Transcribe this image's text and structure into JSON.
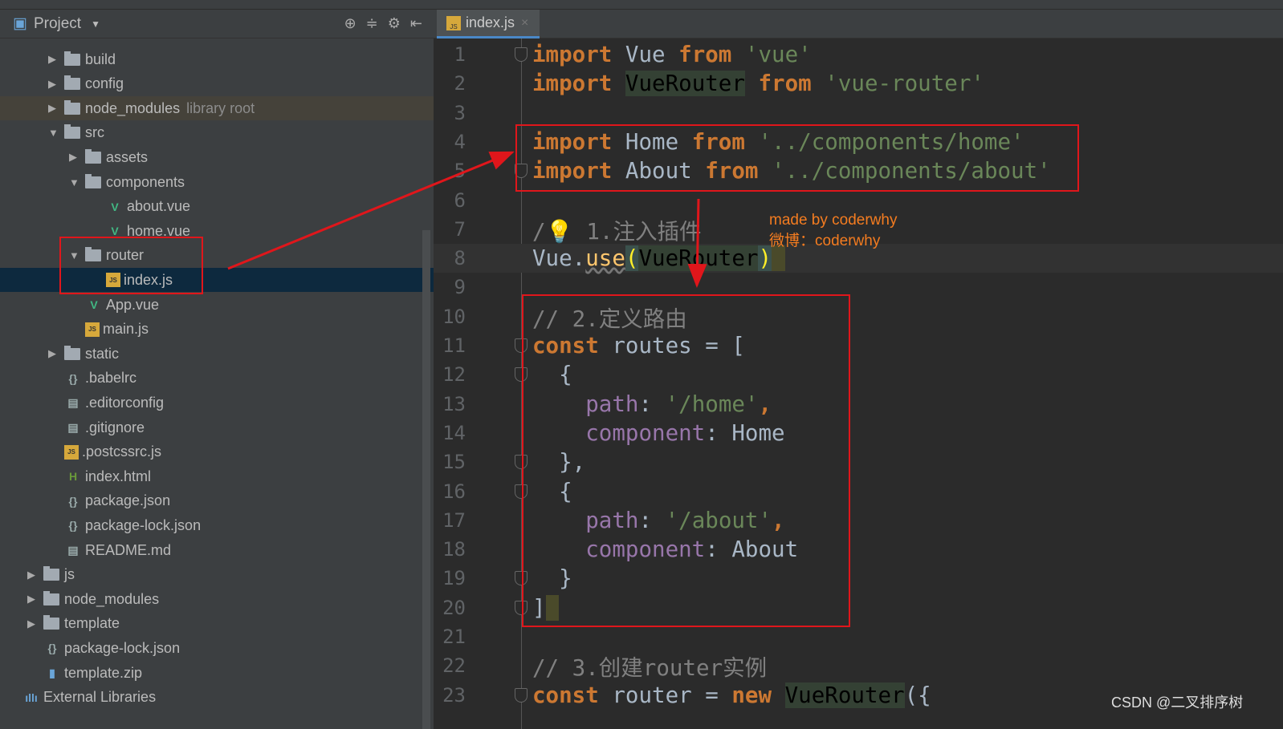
{
  "project_panel": {
    "title": "Project",
    "tools": [
      "⊕",
      "≑",
      "⚙",
      "⇤"
    ],
    "rows": [
      {
        "label": "build",
        "type": "folder",
        "depth": 1,
        "arrow": "right"
      },
      {
        "label": "config",
        "type": "folder",
        "depth": 1,
        "arrow": "right"
      },
      {
        "label": "node_modules",
        "hint": "library root",
        "type": "folder",
        "depth": 1,
        "arrow": "right",
        "lib": true
      },
      {
        "label": "src",
        "type": "folder",
        "depth": 1,
        "arrow": "down"
      },
      {
        "label": "assets",
        "type": "folder",
        "depth": 2,
        "arrow": "right"
      },
      {
        "label": "components",
        "type": "folder",
        "depth": 2,
        "arrow": "down"
      },
      {
        "label": "about.vue",
        "type": "vue",
        "depth": 3
      },
      {
        "label": "home.vue",
        "type": "vue",
        "depth": 3
      },
      {
        "label": "router",
        "type": "folder",
        "depth": 2,
        "arrow": "down"
      },
      {
        "label": "index.js",
        "type": "js",
        "depth": 3,
        "selected": true
      },
      {
        "label": "App.vue",
        "type": "vue",
        "depth": 2
      },
      {
        "label": "main.js",
        "type": "js",
        "depth": 2
      },
      {
        "label": "static",
        "type": "folder",
        "depth": 1,
        "arrow": "right"
      },
      {
        "label": ".babelrc",
        "type": "config",
        "depth": 1
      },
      {
        "label": ".editorconfig",
        "type": "text",
        "depth": 1
      },
      {
        "label": ".gitignore",
        "type": "text",
        "depth": 1
      },
      {
        "label": ".postcssrc.js",
        "type": "js",
        "depth": 1
      },
      {
        "label": "index.html",
        "type": "html",
        "depth": 1
      },
      {
        "label": "package.json",
        "type": "config",
        "depth": 1
      },
      {
        "label": "package-lock.json",
        "type": "config",
        "depth": 1
      },
      {
        "label": "README.md",
        "type": "text",
        "depth": 1
      },
      {
        "label": "js",
        "type": "folder",
        "depth": 0,
        "arrow": "right"
      },
      {
        "label": "node_modules",
        "type": "folder",
        "depth": 0,
        "arrow": "right"
      },
      {
        "label": "template",
        "type": "folder",
        "depth": 0,
        "arrow": "right"
      },
      {
        "label": "package-lock.json",
        "type": "config",
        "depth": 0
      },
      {
        "label": "template.zip",
        "type": "zip",
        "depth": 0
      },
      {
        "label": "External Libraries",
        "type": "libs",
        "depth": -1
      }
    ]
  },
  "editor": {
    "tab": {
      "label": "index.js",
      "close": "×"
    },
    "lines": [
      {
        "n": "1",
        "fold": true,
        "t": [
          [
            "kw",
            "import"
          ],
          [
            "id",
            " Vue "
          ],
          [
            "kw",
            "from"
          ],
          [
            "str",
            " 'vue'"
          ]
        ]
      },
      {
        "n": "2",
        "t": [
          [
            "kw",
            "import"
          ],
          [
            "id",
            " "
          ],
          [
            "hl",
            "VueRouter"
          ],
          [
            "id",
            " "
          ],
          [
            "kw",
            "from"
          ],
          [
            "str",
            " 'vue-router'"
          ]
        ]
      },
      {
        "n": "3",
        "t": []
      },
      {
        "n": "4",
        "t": [
          [
            "kw",
            "import"
          ],
          [
            "id",
            " Home "
          ],
          [
            "kw",
            "from"
          ],
          [
            "str",
            " '../components/home'"
          ]
        ]
      },
      {
        "n": "5",
        "fold": true,
        "t": [
          [
            "kw",
            "import"
          ],
          [
            "id",
            " About "
          ],
          [
            "kw",
            "from"
          ],
          [
            "str",
            " '../components/about'"
          ]
        ]
      },
      {
        "n": "6",
        "t": []
      },
      {
        "n": "7",
        "t": [
          [
            "cm",
            "/💡 1.注入插件"
          ]
        ]
      },
      {
        "n": "8",
        "cur": true,
        "t": [
          [
            "id",
            "Vue."
          ],
          [
            "fn",
            "use"
          ],
          [
            "br",
            "("
          ],
          [
            "hl",
            "VueRouter"
          ],
          [
            "br",
            ")"
          ],
          [
            "caret",
            " "
          ]
        ]
      },
      {
        "n": "9",
        "t": []
      },
      {
        "n": "10",
        "t": [
          [
            "cm",
            "// 2.定义路由"
          ]
        ]
      },
      {
        "n": "11",
        "fold": true,
        "t": [
          [
            "kw",
            "const"
          ],
          [
            "id",
            " routes = ["
          ]
        ]
      },
      {
        "n": "12",
        "fold": true,
        "t": [
          [
            "id",
            "  {"
          ]
        ]
      },
      {
        "n": "13",
        "t": [
          [
            "id",
            "    "
          ],
          [
            "prop",
            "path"
          ],
          [
            "id",
            ": "
          ],
          [
            "str",
            "'/home'"
          ],
          [
            "kw",
            ","
          ]
        ]
      },
      {
        "n": "14",
        "t": [
          [
            "id",
            "    "
          ],
          [
            "prop",
            "component"
          ],
          [
            "id",
            ": Home"
          ]
        ]
      },
      {
        "n": "15",
        "fold": true,
        "t": [
          [
            "id",
            "  },"
          ]
        ]
      },
      {
        "n": "16",
        "fold": true,
        "t": [
          [
            "id",
            "  {"
          ]
        ]
      },
      {
        "n": "17",
        "t": [
          [
            "id",
            "    "
          ],
          [
            "prop",
            "path"
          ],
          [
            "id",
            ": "
          ],
          [
            "str",
            "'/about'"
          ],
          [
            "kw",
            ","
          ]
        ]
      },
      {
        "n": "18",
        "t": [
          [
            "id",
            "    "
          ],
          [
            "prop",
            "component"
          ],
          [
            "id",
            ": About"
          ]
        ]
      },
      {
        "n": "19",
        "fold": true,
        "t": [
          [
            "id",
            "  }"
          ]
        ]
      },
      {
        "n": "20",
        "fold": true,
        "t": [
          [
            "id",
            "]"
          ],
          [
            "caret",
            " "
          ]
        ]
      },
      {
        "n": "21",
        "t": []
      },
      {
        "n": "22",
        "t": [
          [
            "cm",
            "// 3.创建router实例"
          ]
        ]
      },
      {
        "n": "23",
        "fold": true,
        "t": [
          [
            "kw",
            "const"
          ],
          [
            "id",
            " router = "
          ],
          [
            "kw",
            "new"
          ],
          [
            "id",
            " "
          ],
          [
            "hl",
            "VueRouter"
          ],
          [
            "id",
            "({"
          ]
        ]
      }
    ]
  },
  "annotation": {
    "line1": "made by coderwhy",
    "line2": "微博：coderwhy",
    "color": "#f47c20",
    "box_color": "#e0161b"
  },
  "watermark": "CSDN @二叉排序树"
}
